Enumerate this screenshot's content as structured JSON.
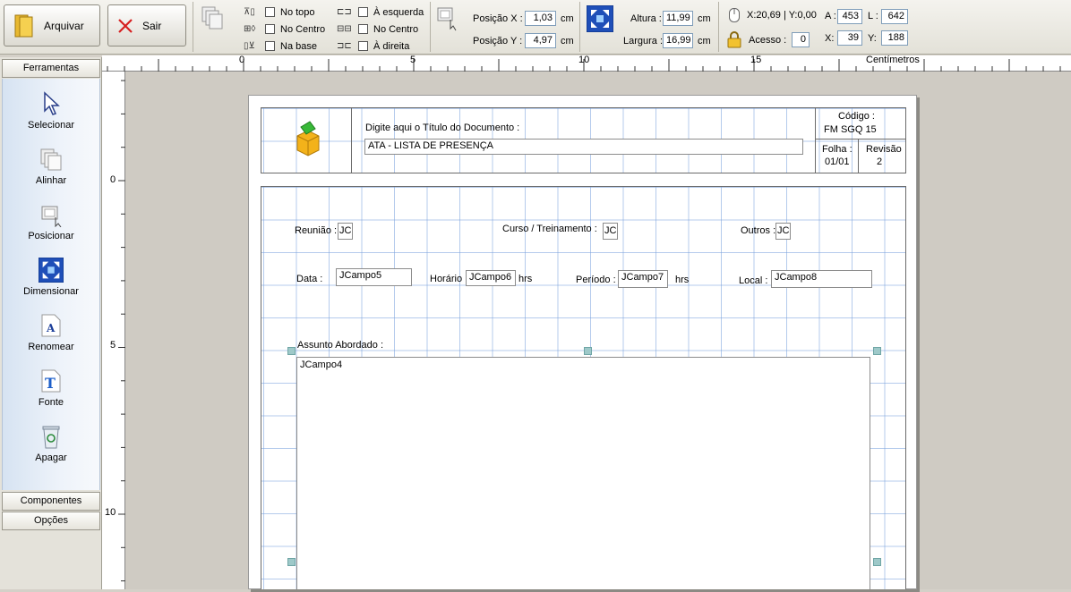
{
  "toolbar": {
    "archive_label": "Arquivar",
    "exit_label": "Sair",
    "align_v": [
      "No topo",
      "No Centro",
      "Na base"
    ],
    "align_h": [
      "À esquerda",
      "No Centro",
      "À direita"
    ],
    "pos_x_label": "Posição X :",
    "pos_x_value": "1,03",
    "pos_y_label": "Posição Y :",
    "pos_y_value": "4,97",
    "unit": "cm",
    "height_label": "Altura :",
    "height_value": "11,99",
    "width_label": "Largura :",
    "width_value": "16,99",
    "coords_text": "X:20,69 | Y:0,00",
    "access_label": "Acesso :",
    "access_value": "0",
    "a_label": "A :",
    "a_value": "453",
    "l_label": "L :",
    "l_value": "642",
    "x_label": "X:",
    "x_value": "39",
    "y_label": "Y:",
    "y_value": "188"
  },
  "left_panel": {
    "header": "Ferramentas",
    "tools": [
      "Selecionar",
      "Alinhar",
      "Posicionar",
      "Dimensionar",
      "Renomear",
      "Fonte",
      "Apagar"
    ],
    "components": "Componentes",
    "options": "Opções"
  },
  "ruler": {
    "h_labels": [
      "0",
      "5",
      "10",
      "15"
    ],
    "unit_label": "Centímetros",
    "v_labels": [
      "0",
      "5",
      "10"
    ]
  },
  "document": {
    "title_caption": "Digite aqui o Título do Documento :",
    "title_value": "ATA - LISTA DE PRESENÇA",
    "code_label": "Código :",
    "code_value": "FM  SGQ 15",
    "sheet_label": "Folha :",
    "sheet_value": "01/01",
    "revision_label": "Revisão",
    "revision_value": "2",
    "meeting_label": "Reunião :",
    "meeting_value": "JC",
    "course_label": "Curso / Treinamento :",
    "course_value": "JC",
    "others_label": "Outros :",
    "others_value": "JC",
    "date_label": "Data :",
    "date_value": "JCampo5",
    "time_label": "Horário :",
    "time_value": "JCampo6",
    "time_unit": "hrs",
    "period_label": "Período :",
    "period_value": "JCampo7",
    "period_unit": "hrs",
    "place_label": "Local :",
    "place_value": "JCampo8",
    "subject_label": "Assunto Abordado :",
    "subject_value": "JCampo4"
  }
}
